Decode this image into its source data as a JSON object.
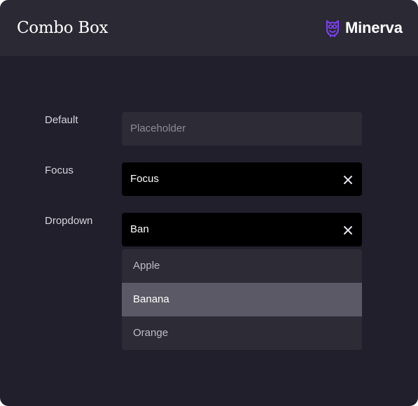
{
  "header": {
    "title": "Combo Box",
    "brand_name": "Minerva",
    "brand_icon": "owl-icon",
    "brand_color": "#7b3ff2"
  },
  "rows": {
    "default": {
      "label": "Default",
      "placeholder": "Placeholder"
    },
    "focus": {
      "label": "Focus",
      "value": "Focus",
      "clear_icon": "close-icon"
    },
    "dropdown": {
      "label": "Dropdown",
      "value": "Ban",
      "clear_icon": "close-icon",
      "options": [
        {
          "label": "Apple",
          "highlighted": false
        },
        {
          "label": "Banana",
          "highlighted": true
        },
        {
          "label": "Orange",
          "highlighted": false
        }
      ]
    }
  },
  "colors": {
    "background": "#201f2b",
    "header": "#2a2934",
    "field_default": "#2c2b36",
    "field_active": "#000000",
    "option_highlight": "#5a5965"
  }
}
